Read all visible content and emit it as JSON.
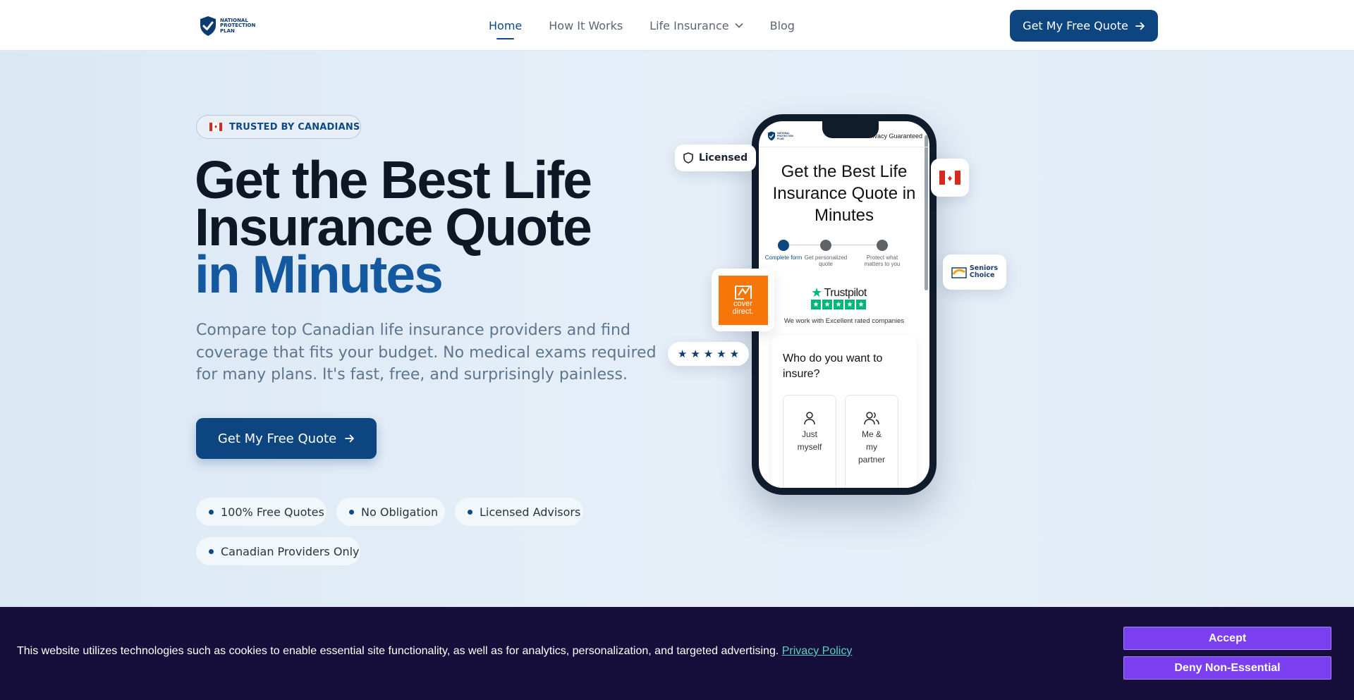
{
  "header": {
    "logo_text": "NATIONAL PROTECTION PLAN",
    "nav": [
      {
        "label": "Home",
        "active": true
      },
      {
        "label": "How It Works"
      },
      {
        "label": "Life Insurance",
        "has_dropdown": true
      },
      {
        "label": "Blog"
      }
    ],
    "cta_label": "Get My Free Quote",
    "cta_icon": "arrow-right-icon"
  },
  "hero": {
    "badge_text": "TRUSTED BY CANADIANS",
    "headline_part1": "Get the Best Life Insurance Quote",
    "headline_accent": "in Minutes",
    "subtext": "Compare top Canadian life insurance providers and find coverage that fits your budget. No medical exams required for many plans. It's fast, free, and surprisingly painless.",
    "cta_label": "Get My Free Quote",
    "pills": [
      "100% Free Quotes",
      "No Obligation",
      "Licensed Advisors",
      "Canadian Providers Only"
    ]
  },
  "phone": {
    "logo_text": "NATIONAL PROTECTION PLAN",
    "privacy_text": "Privacy Guaranteed",
    "title": "Get the Best Life Insurance Quote in Minutes",
    "steps": [
      "Complete form",
      "Get personalized quote",
      "Protect what matters to you"
    ],
    "trustpilot_label": "Trustpilot",
    "trustpilot_text": "We work with Excellent rated companies",
    "question": "Who do you want to insure?",
    "options": [
      "Just myself",
      "Me & my partner"
    ]
  },
  "floats": {
    "licensed_label": "Licensed",
    "seniors_label_1": "Seniors",
    "seniors_label_2": "Choice",
    "cover_label_1": "cover",
    "cover_label_2": "direct."
  },
  "cookie": {
    "text": "This website utilizes technologies such as cookies to enable essential site functionality, as well as for analytics, personalization, and targeted advertising.",
    "link_text": "Privacy Policy",
    "accept_label": "Accept",
    "deny_label": "Deny Non-Essential"
  },
  "colors": {
    "brand": "#0d4580",
    "accent_text": "#1459a0",
    "cookie_bg": "#160f3c",
    "cookie_button": "#7b3ff0",
    "trustpilot": "#00b67a"
  }
}
